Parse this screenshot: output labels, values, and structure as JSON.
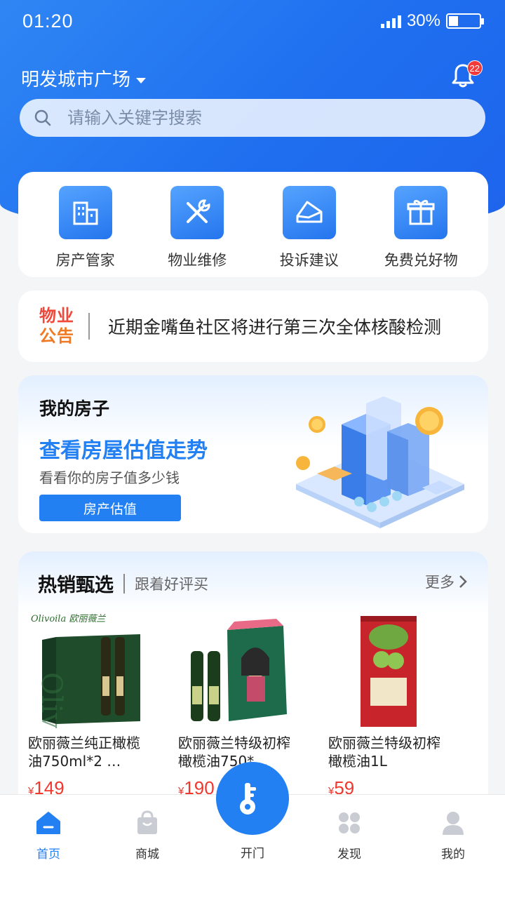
{
  "status": {
    "time": "01:20",
    "battery": "30%",
    "battery_level": 0.3
  },
  "header": {
    "location": "明发城市广场",
    "notification_count": "22"
  },
  "search": {
    "placeholder": "请输入关键字搜索"
  },
  "quick_actions": [
    {
      "label": "房产管家",
      "icon": "building-icon"
    },
    {
      "label": "物业维修",
      "icon": "tools-icon"
    },
    {
      "label": "投诉建议",
      "icon": "envelope-icon"
    },
    {
      "label": "免费兑好物",
      "icon": "gift-icon"
    }
  ],
  "notice": {
    "logo_line1": "物业",
    "logo_line2": "公告",
    "text": "近期金嘴鱼社区将进行第三次全体核酸检测"
  },
  "house": {
    "title": "我的房子",
    "headline": "查看房屋估值走势",
    "subtitle": "看看你的房子值多少钱",
    "button": "房产估值"
  },
  "hot": {
    "title": "热销甄选",
    "subtitle": "跟着好评买",
    "more": "更多",
    "products": [
      {
        "name": "欧丽薇兰纯正橄榄油750ml*2 …",
        "price": "149",
        "currency": "¥",
        "brand": "Olivoila 欧丽薇兰"
      },
      {
        "name": "欧丽薇兰特级初榨橄榄油750*…",
        "price": "190",
        "currency": "¥"
      },
      {
        "name": "欧丽薇兰特级初榨橄榄油1L",
        "price": "59",
        "currency": "¥"
      }
    ]
  },
  "tabs": {
    "home": "首页",
    "mall": "商城",
    "open": "开门",
    "discover": "发现",
    "mine": "我的"
  },
  "colors": {
    "primary": "#2280f2",
    "notice_red": "#f0493a",
    "notice_orange": "#f07a24",
    "price": "#f0382e"
  }
}
